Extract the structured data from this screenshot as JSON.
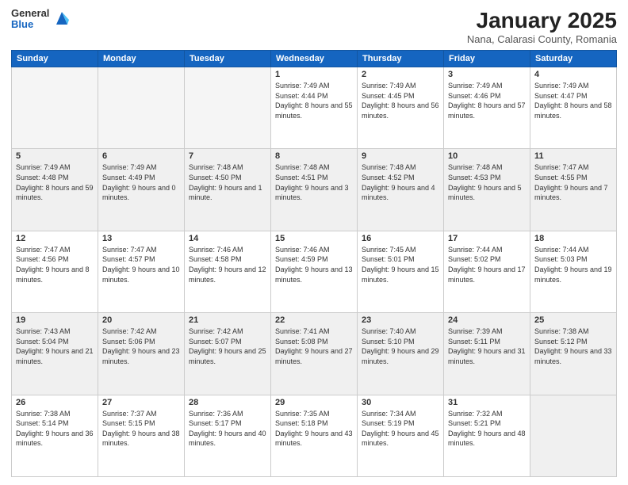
{
  "header": {
    "logo_general": "General",
    "logo_blue": "Blue",
    "month_title": "January 2025",
    "location": "Nana, Calarasi County, Romania"
  },
  "weekdays": [
    "Sunday",
    "Monday",
    "Tuesday",
    "Wednesday",
    "Thursday",
    "Friday",
    "Saturday"
  ],
  "weeks": [
    [
      {
        "day": "",
        "info": ""
      },
      {
        "day": "",
        "info": ""
      },
      {
        "day": "",
        "info": ""
      },
      {
        "day": "1",
        "info": "Sunrise: 7:49 AM\nSunset: 4:44 PM\nDaylight: 8 hours\nand 55 minutes."
      },
      {
        "day": "2",
        "info": "Sunrise: 7:49 AM\nSunset: 4:45 PM\nDaylight: 8 hours\nand 56 minutes."
      },
      {
        "day": "3",
        "info": "Sunrise: 7:49 AM\nSunset: 4:46 PM\nDaylight: 8 hours\nand 57 minutes."
      },
      {
        "day": "4",
        "info": "Sunrise: 7:49 AM\nSunset: 4:47 PM\nDaylight: 8 hours\nand 58 minutes."
      }
    ],
    [
      {
        "day": "5",
        "info": "Sunrise: 7:49 AM\nSunset: 4:48 PM\nDaylight: 8 hours\nand 59 minutes."
      },
      {
        "day": "6",
        "info": "Sunrise: 7:49 AM\nSunset: 4:49 PM\nDaylight: 9 hours\nand 0 minutes."
      },
      {
        "day": "7",
        "info": "Sunrise: 7:48 AM\nSunset: 4:50 PM\nDaylight: 9 hours\nand 1 minute."
      },
      {
        "day": "8",
        "info": "Sunrise: 7:48 AM\nSunset: 4:51 PM\nDaylight: 9 hours\nand 3 minutes."
      },
      {
        "day": "9",
        "info": "Sunrise: 7:48 AM\nSunset: 4:52 PM\nDaylight: 9 hours\nand 4 minutes."
      },
      {
        "day": "10",
        "info": "Sunrise: 7:48 AM\nSunset: 4:53 PM\nDaylight: 9 hours\nand 5 minutes."
      },
      {
        "day": "11",
        "info": "Sunrise: 7:47 AM\nSunset: 4:55 PM\nDaylight: 9 hours\nand 7 minutes."
      }
    ],
    [
      {
        "day": "12",
        "info": "Sunrise: 7:47 AM\nSunset: 4:56 PM\nDaylight: 9 hours\nand 8 minutes."
      },
      {
        "day": "13",
        "info": "Sunrise: 7:47 AM\nSunset: 4:57 PM\nDaylight: 9 hours\nand 10 minutes."
      },
      {
        "day": "14",
        "info": "Sunrise: 7:46 AM\nSunset: 4:58 PM\nDaylight: 9 hours\nand 12 minutes."
      },
      {
        "day": "15",
        "info": "Sunrise: 7:46 AM\nSunset: 4:59 PM\nDaylight: 9 hours\nand 13 minutes."
      },
      {
        "day": "16",
        "info": "Sunrise: 7:45 AM\nSunset: 5:01 PM\nDaylight: 9 hours\nand 15 minutes."
      },
      {
        "day": "17",
        "info": "Sunrise: 7:44 AM\nSunset: 5:02 PM\nDaylight: 9 hours\nand 17 minutes."
      },
      {
        "day": "18",
        "info": "Sunrise: 7:44 AM\nSunset: 5:03 PM\nDaylight: 9 hours\nand 19 minutes."
      }
    ],
    [
      {
        "day": "19",
        "info": "Sunrise: 7:43 AM\nSunset: 5:04 PM\nDaylight: 9 hours\nand 21 minutes."
      },
      {
        "day": "20",
        "info": "Sunrise: 7:42 AM\nSunset: 5:06 PM\nDaylight: 9 hours\nand 23 minutes."
      },
      {
        "day": "21",
        "info": "Sunrise: 7:42 AM\nSunset: 5:07 PM\nDaylight: 9 hours\nand 25 minutes."
      },
      {
        "day": "22",
        "info": "Sunrise: 7:41 AM\nSunset: 5:08 PM\nDaylight: 9 hours\nand 27 minutes."
      },
      {
        "day": "23",
        "info": "Sunrise: 7:40 AM\nSunset: 5:10 PM\nDaylight: 9 hours\nand 29 minutes."
      },
      {
        "day": "24",
        "info": "Sunrise: 7:39 AM\nSunset: 5:11 PM\nDaylight: 9 hours\nand 31 minutes."
      },
      {
        "day": "25",
        "info": "Sunrise: 7:38 AM\nSunset: 5:12 PM\nDaylight: 9 hours\nand 33 minutes."
      }
    ],
    [
      {
        "day": "26",
        "info": "Sunrise: 7:38 AM\nSunset: 5:14 PM\nDaylight: 9 hours\nand 36 minutes."
      },
      {
        "day": "27",
        "info": "Sunrise: 7:37 AM\nSunset: 5:15 PM\nDaylight: 9 hours\nand 38 minutes."
      },
      {
        "day": "28",
        "info": "Sunrise: 7:36 AM\nSunset: 5:17 PM\nDaylight: 9 hours\nand 40 minutes."
      },
      {
        "day": "29",
        "info": "Sunrise: 7:35 AM\nSunset: 5:18 PM\nDaylight: 9 hours\nand 43 minutes."
      },
      {
        "day": "30",
        "info": "Sunrise: 7:34 AM\nSunset: 5:19 PM\nDaylight: 9 hours\nand 45 minutes."
      },
      {
        "day": "31",
        "info": "Sunrise: 7:32 AM\nSunset: 5:21 PM\nDaylight: 9 hours\nand 48 minutes."
      },
      {
        "day": "",
        "info": ""
      }
    ]
  ]
}
